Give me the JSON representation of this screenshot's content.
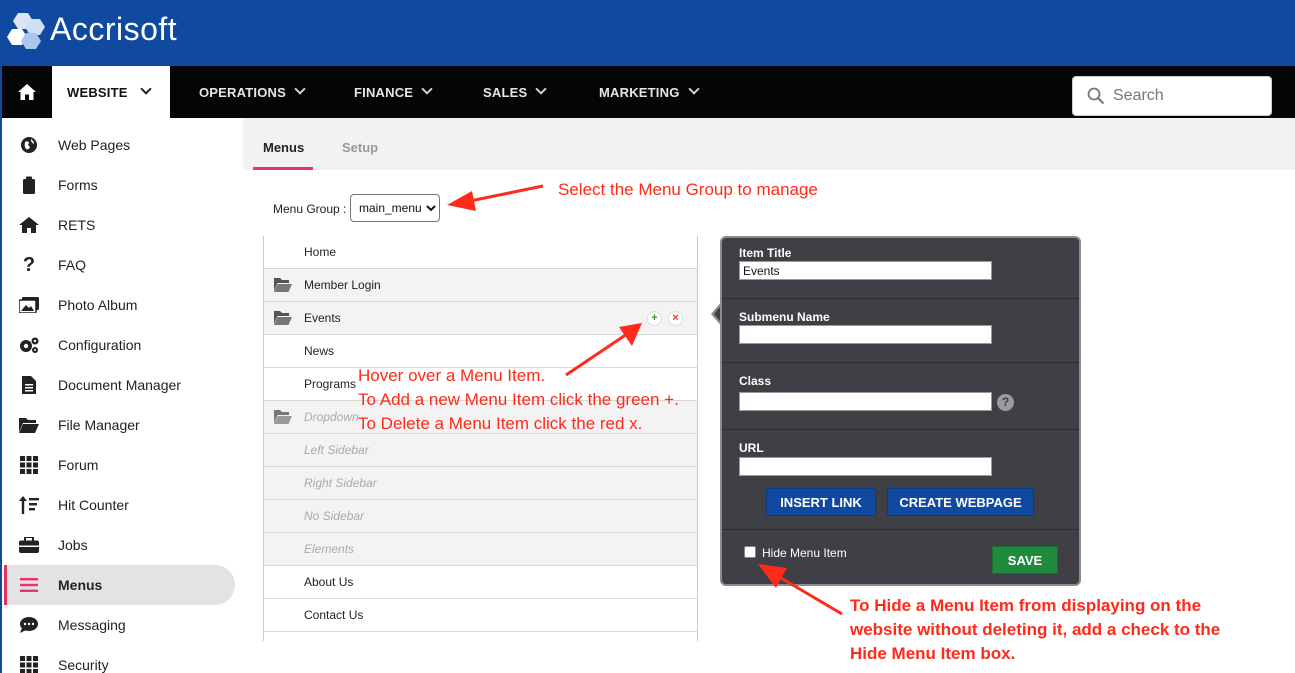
{
  "brand": {
    "name": "Accrisoft",
    "color": "#0f4aa0"
  },
  "nav": {
    "items": [
      {
        "label": "WEBSITE"
      },
      {
        "label": "OPERATIONS"
      },
      {
        "label": "FINANCE"
      },
      {
        "label": "SALES"
      },
      {
        "label": "MARKETING"
      }
    ],
    "search_placeholder": "Search"
  },
  "sidebar": {
    "items": [
      {
        "label": "Web Pages",
        "icon": "globe-icon"
      },
      {
        "label": "Forms",
        "icon": "clipboard-icon"
      },
      {
        "label": "RETS",
        "icon": "home-icon"
      },
      {
        "label": "FAQ",
        "icon": "question-icon"
      },
      {
        "label": "Photo Album",
        "icon": "photo-icon"
      },
      {
        "label": "Configuration",
        "icon": "gears-icon"
      },
      {
        "label": "Document Manager",
        "icon": "document-icon"
      },
      {
        "label": "File Manager",
        "icon": "folder-icon"
      },
      {
        "label": "Forum",
        "icon": "grid-icon"
      },
      {
        "label": "Hit Counter",
        "icon": "sort-icon"
      },
      {
        "label": "Jobs",
        "icon": "briefcase-icon"
      },
      {
        "label": "Menus",
        "icon": "menu-icon"
      },
      {
        "label": "Messaging",
        "icon": "chat-icon"
      },
      {
        "label": "Security",
        "icon": "grid-icon"
      }
    ],
    "active": "Menus",
    "accent": "#e8336a"
  },
  "tabs": [
    {
      "label": "Menus"
    },
    {
      "label": "Setup"
    }
  ],
  "menu_group": {
    "label": "Menu Group :",
    "value": "main_menu"
  },
  "menu_items": [
    {
      "label": "Home"
    },
    {
      "label": "Member Login"
    },
    {
      "label": "Events"
    },
    {
      "label": "News"
    },
    {
      "label": "Programs"
    },
    {
      "label": "Dropdown"
    },
    {
      "label": "Left Sidebar"
    },
    {
      "label": "Right Sidebar"
    },
    {
      "label": "No Sidebar"
    },
    {
      "label": "Elements"
    },
    {
      "label": "About Us"
    },
    {
      "label": "Contact Us"
    }
  ],
  "edit_panel": {
    "item_title_label": "Item Title",
    "item_title_value": "Events",
    "submenu_label": "Submenu Name",
    "submenu_value": "",
    "class_label": "Class",
    "class_value": "",
    "help": "?",
    "url_label": "URL",
    "url_value": "",
    "insert_link": "INSERT LINK",
    "create_webpage": "CREATE WEBPAGE",
    "hide_label": "Hide Menu Item",
    "hide_checked": false,
    "save": "SAVE"
  },
  "row_actions": {
    "add": "+",
    "delete": "×",
    "add_color": "#2e9a2e",
    "delete_color": "#e53935"
  },
  "annotations": {
    "select_group": "Select the Menu Group to manage",
    "hover_line1": "Hover over a Menu Item.",
    "hover_line2": "To Add a new Menu Item click the green +.",
    "hover_line3": "To Delete a Menu Item click the red x.",
    "hide_line1": "To Hide a Menu Item from displaying on the",
    "hide_line2": "website without deleting it, add a check to the",
    "hide_line3": "Hide Menu Item box.",
    "color": "#ff2a1a"
  }
}
